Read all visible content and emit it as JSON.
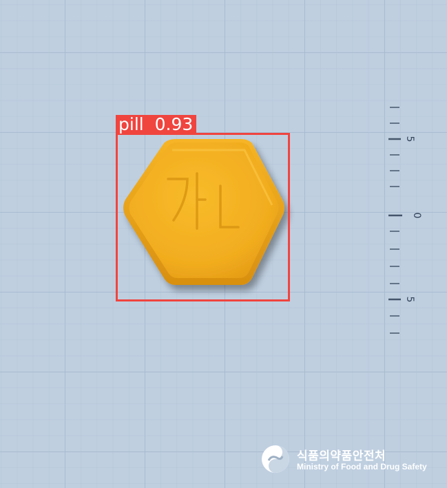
{
  "detection": {
    "label": "pill",
    "score": "0.93",
    "box_color": "#f0443f"
  },
  "pill": {
    "shape": "hexagon",
    "color": "#f4b323",
    "imprint": "가L"
  },
  "ruler": {
    "labels": [
      "5",
      "0",
      "5"
    ],
    "orientation": "vertical"
  },
  "logo": {
    "korean_text": "식품의약품안전처",
    "english_text": "Ministry of Food and Drug Safety"
  },
  "background": {
    "color": "#bfcfe0",
    "grid": true
  }
}
